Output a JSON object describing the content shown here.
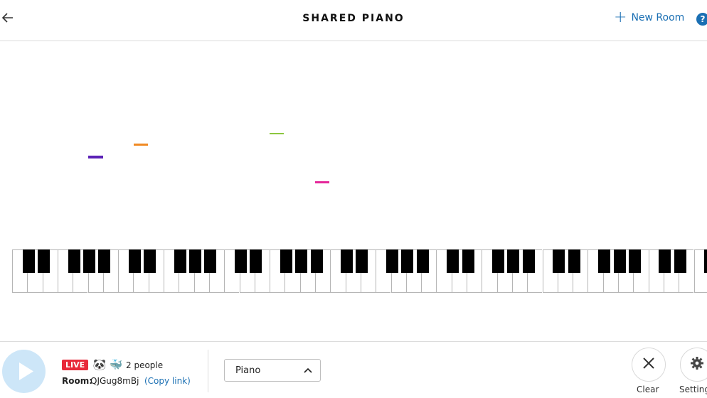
{
  "header": {
    "back_icon": "arrow-left-icon",
    "title": "SHARED PIANO",
    "new_room_label": "New Room",
    "help_label": "?"
  },
  "notes": [
    {
      "color": "#5b21b6"
    },
    {
      "color": "#f08a24"
    },
    {
      "color": "#8cc63f"
    },
    {
      "color": "#e5279a"
    }
  ],
  "keyboard": {
    "white_keys_visible": 46,
    "black_key_pattern": "2-3"
  },
  "footer": {
    "play_icon": "play-icon",
    "live_label": "LIVE",
    "avatars": [
      "🐼",
      "🐳"
    ],
    "people_count": "2 people",
    "room_label": "Room:",
    "room_code": "QJGug8mBj",
    "copy_link_label": "(Copy link)",
    "instrument_selected": "Piano",
    "clear_label": "Clear",
    "settings_label": "Settings"
  },
  "colors": {
    "accent": "#1a6fb3",
    "live": "#e8293a",
    "play_bg": "#cde6f8"
  }
}
